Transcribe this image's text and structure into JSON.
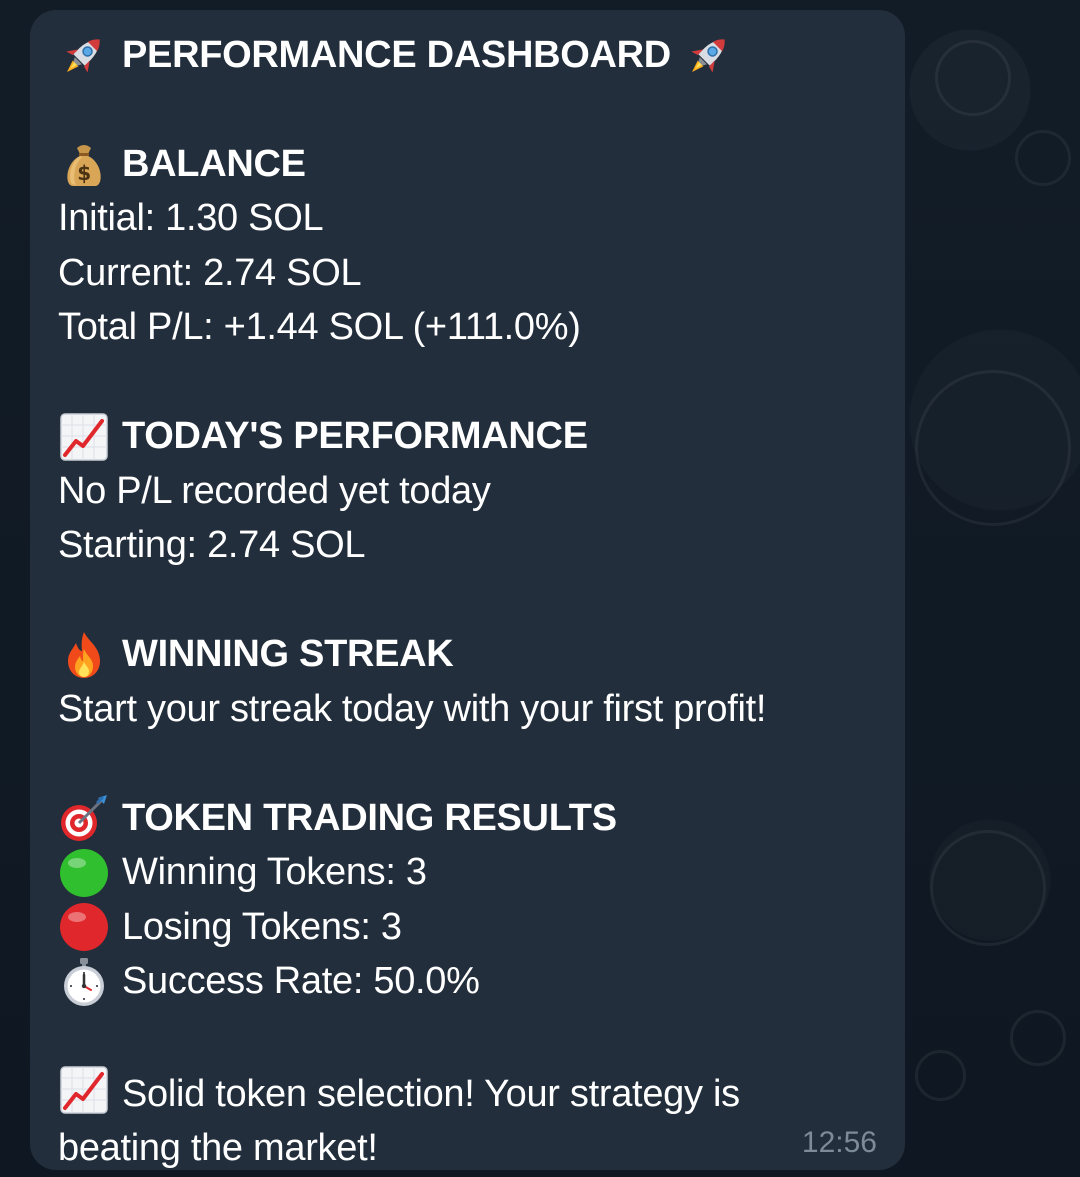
{
  "message": {
    "title": "PERFORMANCE DASHBOARD",
    "balance": {
      "heading": "BALANCE",
      "initial": "Initial: 1.30 SOL",
      "current": "Current: 2.74 SOL",
      "total_pl": "Total P/L: +1.44 SOL (+111.0%)"
    },
    "today": {
      "heading": "TODAY'S PERFORMANCE",
      "no_pl": "No P/L recorded yet today",
      "starting": "Starting: 2.74 SOL"
    },
    "streak": {
      "heading": "WINNING STREAK",
      "text": "Start your streak today with your first profit!"
    },
    "token_results": {
      "heading": "TOKEN TRADING RESULTS",
      "winning": "Winning Tokens: 3",
      "losing": "Losing Tokens: 3",
      "success_rate": "Success Rate: 50.0%"
    },
    "footer": "Solid token selection! Your strategy is beating the market!",
    "time": "12:56"
  },
  "icons": {
    "rocket": "rocket-icon",
    "balance": "money-bag-icon",
    "today": "chart-increasing-icon",
    "streak": "fire-icon",
    "results": "direct-hit-icon",
    "winning": "green-circle-icon",
    "losing": "red-circle-icon",
    "success": "stopwatch-icon",
    "footer": "chart-increasing-icon"
  },
  "colors": {
    "background": "#0e1621",
    "bubble": "#222e3b",
    "text": "#ffffff",
    "timestamp": "#7d8b99",
    "green": "#2fbf2f",
    "red": "#e0272b"
  }
}
